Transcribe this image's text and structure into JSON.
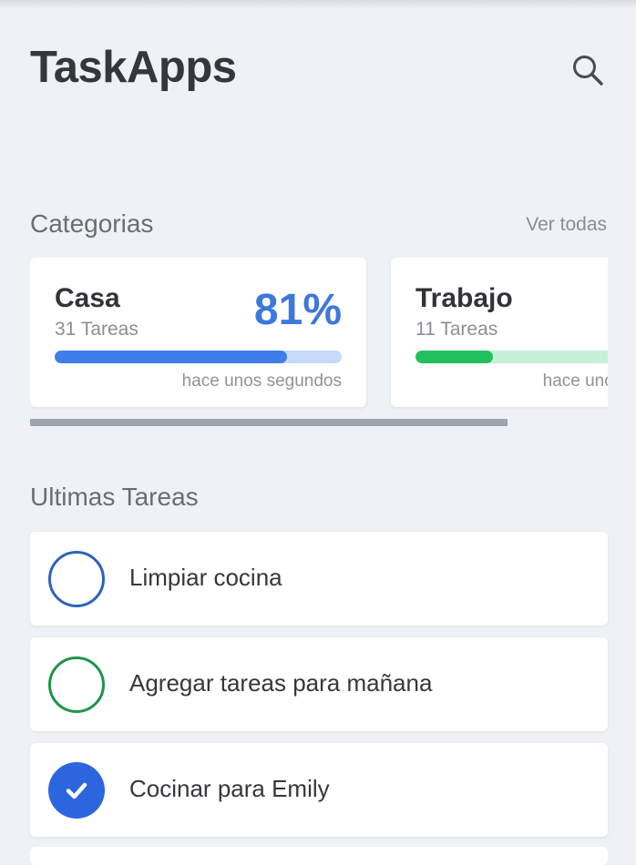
{
  "header": {
    "title": "TaskApps",
    "search_icon": "search-icon"
  },
  "categories": {
    "title": "Categorias",
    "see_all": "Ver todas",
    "items": [
      {
        "name": "Casa",
        "count": "31 Tareas",
        "percent": "81%",
        "progress": 0.81,
        "time": "hace unos segundos",
        "color": "#3d7ee8",
        "track_color": "#c6dbf8"
      },
      {
        "name": "Trabajo",
        "count": "11 Tareas",
        "progress": 0.27,
        "time": "hace unos segundos",
        "color": "#22c05d",
        "track_color": "#c7f0d6"
      }
    ]
  },
  "tasks": {
    "title": "Ultimas Tareas",
    "items": [
      {
        "label": "Limpiar cocina",
        "done": false,
        "color": "#2e63b8"
      },
      {
        "label": "Agregar tareas para mañana",
        "done": false,
        "color": "#1f944a"
      },
      {
        "label": "Cocinar para Emily",
        "done": true,
        "color": "#2c66df"
      }
    ]
  }
}
